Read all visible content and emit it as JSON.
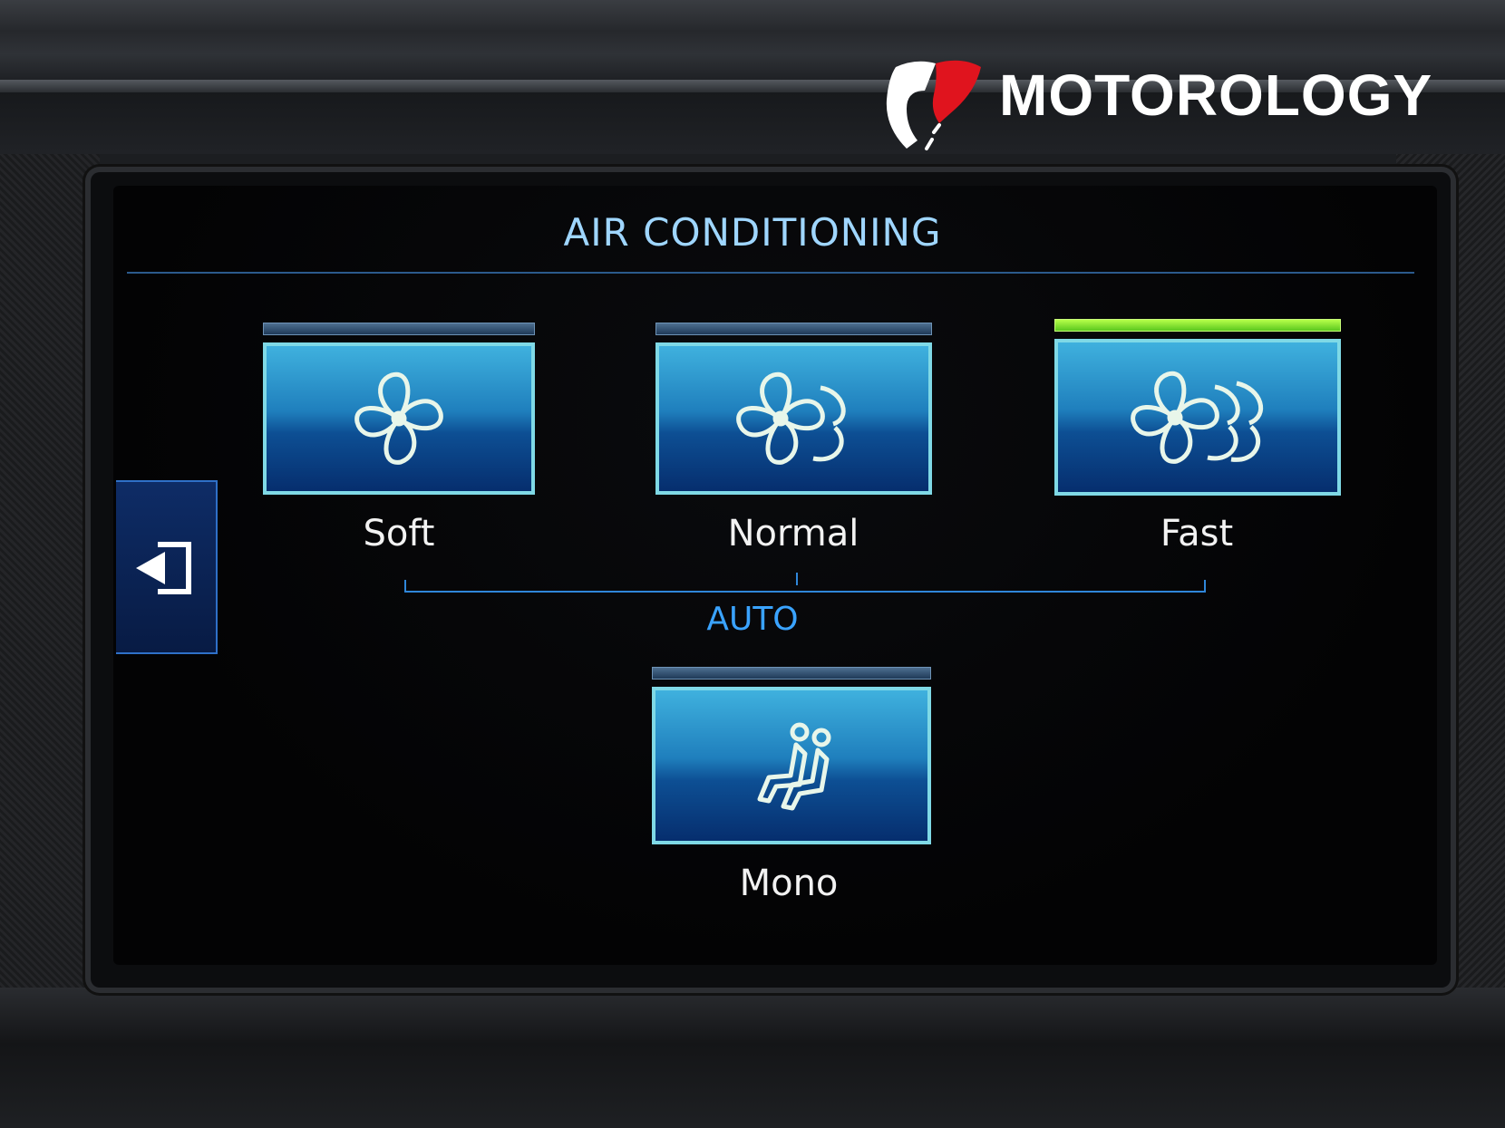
{
  "watermark": {
    "brand_text": "MOTOROLOGY"
  },
  "header": {
    "title": "AIR CONDITIONING"
  },
  "back_button": {
    "icon": "back-arrow-icon"
  },
  "modes": [
    {
      "label": "Soft",
      "icon": "fan-single-icon",
      "active": false
    },
    {
      "label": "Normal",
      "icon": "fan-double-icon",
      "active": false
    },
    {
      "label": "Fast",
      "icon": "fan-triple-icon",
      "active": true
    }
  ],
  "auto_group": {
    "label": "AUTO"
  },
  "mono": {
    "label": "Mono",
    "icon": "seated-passengers-icon",
    "active": false
  },
  "colors": {
    "title": "#9fd6ff",
    "accent_blue": "#3aa3ff",
    "active_indicator": "#8de63a",
    "tile_border": "#7fd9e6"
  }
}
